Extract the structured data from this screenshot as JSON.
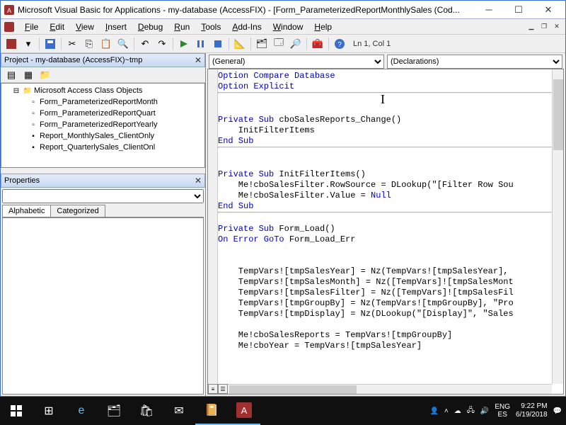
{
  "titlebar": {
    "title": "Microsoft Visual Basic for Applications - my-database (AccessFIX) - [Form_ParameterizedReportMonthlySales (Cod..."
  },
  "menu": {
    "file": "File",
    "edit": "Edit",
    "view": "View",
    "insert": "Insert",
    "debug": "Debug",
    "run": "Run",
    "tools": "Tools",
    "addins": "Add-Ins",
    "window": "Window",
    "help": "Help"
  },
  "toolbar": {
    "status": "Ln 1, Col 1"
  },
  "project": {
    "title": "Project - my-database (AccessFIX)~tmp",
    "folder": "Microsoft Access Class Objects",
    "items": [
      "Form_ParameterizedReportMonth",
      "Form_ParameterizedReportQuart",
      "Form_ParameterizedReportYearly",
      "Report_MonthlySales_ClientOnly",
      "Report_QuarterlySales_ClientOnl"
    ]
  },
  "properties": {
    "title": "Properties",
    "tab_alpha": "Alphabetic",
    "tab_cat": "Categorized"
  },
  "code": {
    "object_dd": "(General)",
    "proc_dd": "(Declarations)",
    "lines": {
      "l1": "Option Compare Database",
      "l2": "Option Explicit",
      "l3": "Private Sub cboSalesReports_Change()",
      "l4": "    InitFilterItems",
      "l5": "End Sub",
      "l6": "Private Sub InitFilterItems()",
      "l7": "    Me!cboSalesFilter.RowSource = DLookup(\"[Filter Row Sou",
      "l8": "    Me!cboSalesFilter.Value = Null",
      "l9": "End Sub",
      "l10": "Private Sub Form_Load()",
      "l11": "On Error GoTo Form_Load_Err",
      "l12": "    TempVars![tmpSalesYear] = Nz(TempVars![tmpSalesYear], ",
      "l13": "    TempVars![tmpSalesMonth] = Nz([TempVars]![tmpSalesMont",
      "l14": "    TempVars![tmpSalesFilter] = Nz([TempVars]![tmpSalesFil",
      "l15": "    TempVars![tmpGroupBy] = Nz(TempVars![tmpGroupBy], \"Pro",
      "l16": "    TempVars![tmpDisplay] = Nz(DLookup(\"[Display]\", \"Sales",
      "l17": "    Me!cboSalesReports = TempVars![tmpGroupBy]",
      "l18": "    Me!cboYear = TempVars![tmpSalesYear]"
    }
  },
  "tray": {
    "lang1": "ENG",
    "lang2": "ES",
    "time": "9:22 PM",
    "date": "6/19/2018"
  }
}
